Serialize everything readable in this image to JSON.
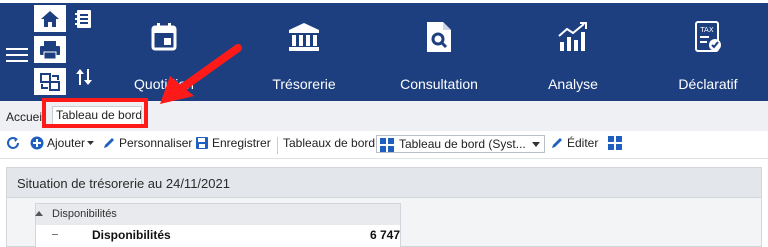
{
  "top_nav": {
    "items": [
      {
        "label": "Quotidien"
      },
      {
        "label": "Trésorerie"
      },
      {
        "label": "Consultation"
      },
      {
        "label": "Analyse"
      },
      {
        "label": "Déclaratif"
      }
    ]
  },
  "breadcrumb": {
    "home": "Accueil",
    "current": "Tableau de bord"
  },
  "toolbar": {
    "ajouter": "Ajouter",
    "personnaliser": "Personnaliser",
    "enregistrer": "Enregistrer",
    "tableaux_label": "Tableaux de bord",
    "selected_dashboard": "Tableau de bord (Syst...",
    "editer": "Éditer"
  },
  "panel": {
    "title": "Situation de trésorerie au 24/11/2021",
    "subpanel_title": "Disponibilités",
    "row_label": "Disponibilités",
    "row_value": "6 747"
  },
  "colors": {
    "nav_bg": "#1d3f80",
    "highlight": "#ff1a1a",
    "accent": "#1f5fbf"
  }
}
